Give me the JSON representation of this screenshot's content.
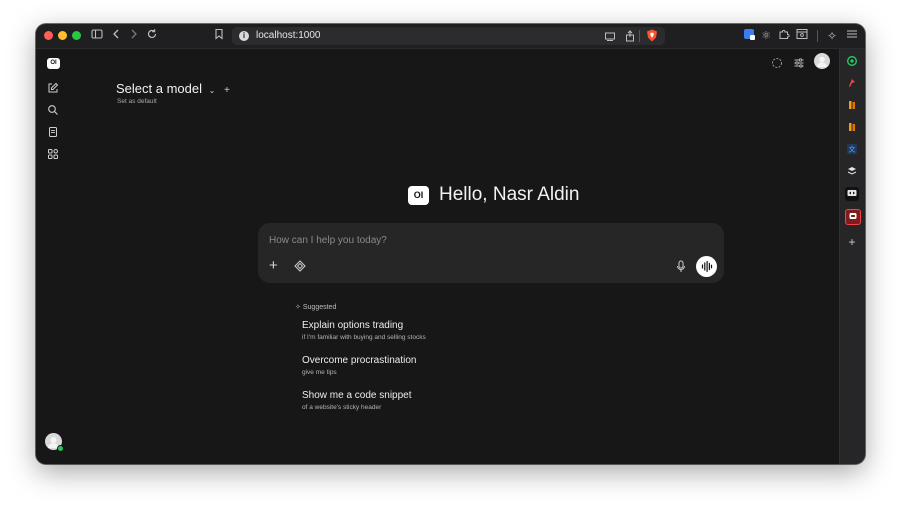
{
  "browser": {
    "url": "localhost:1000",
    "traffic_lights": [
      "#ff5f57",
      "#febc2e",
      "#28c840"
    ]
  },
  "header": {
    "model_label": "Select a model",
    "set_default": "Set as default"
  },
  "logo_text": "OI",
  "greeting": "Hello, Nasr Aldin",
  "chat": {
    "placeholder": "How can I help you today?"
  },
  "suggested": {
    "label": "Suggested",
    "items": [
      {
        "title": "Explain options trading",
        "subtitle": "if I'm familiar with buying and selling stocks"
      },
      {
        "title": "Overcome procrastination",
        "subtitle": "give me tips"
      },
      {
        "title": "Show me a code snippet",
        "subtitle": "of a website's sticky header"
      }
    ]
  },
  "colors": {
    "background": "#171717",
    "chatbox": "#262626",
    "text": "#f2f2f2",
    "muted": "#a8a8a8",
    "brave_orange": "#fb542b"
  }
}
